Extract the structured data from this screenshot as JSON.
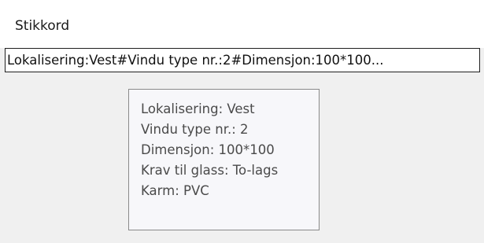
{
  "header": {
    "column_label": "Stikkord"
  },
  "cell": {
    "value": "Lokalisering:Vest#Vindu type nr.:2#Dimensjon:100*100..."
  },
  "tooltip": {
    "lines": [
      "Lokalisering: Vest",
      "Vindu type nr.: 2",
      "Dimensjon: 100*100",
      "Krav til glass: To-lags",
      "Karm: PVC"
    ]
  }
}
